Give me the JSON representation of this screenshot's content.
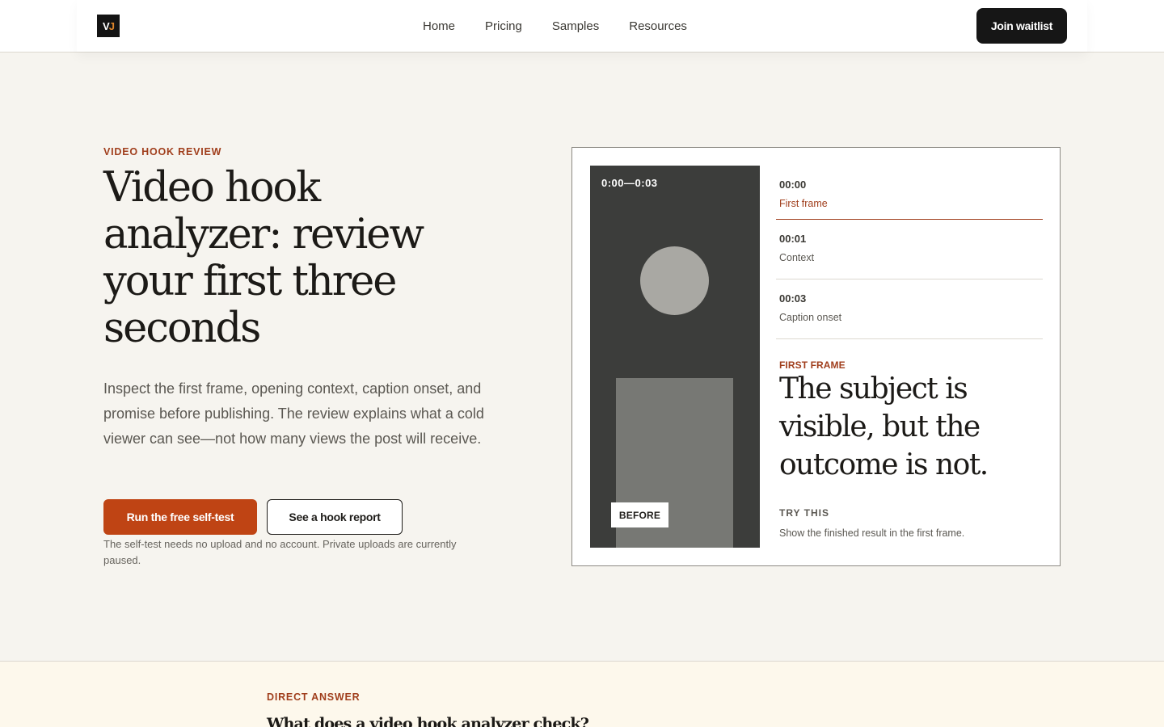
{
  "header": {
    "logo_text_1": "V",
    "logo_text_2": "J",
    "nav": [
      "Home",
      "Pricing",
      "Samples",
      "Resources"
    ],
    "cta": "Join waitlist"
  },
  "hero": {
    "eyebrow": "VIDEO HOOK REVIEW",
    "title": "Video hook analyzer: review your first three seconds",
    "description": "Inspect the first frame, opening context, caption onset, and promise before publishing. The review explains what a cold viewer can see—not how many views the post will receive.",
    "primary_cta": "Run the free self-test",
    "secondary_cta": "See a hook report",
    "note": "The self-test needs no upload and no account. Private uploads are currently paused."
  },
  "preview": {
    "time_range": "0:00—0:03",
    "badge": "BEFORE",
    "timeline": [
      {
        "time": "00:00",
        "label": "First frame"
      },
      {
        "time": "00:01",
        "label": "Context"
      },
      {
        "time": "00:03",
        "label": "Caption onset"
      }
    ],
    "active_index": 0,
    "finding_eyebrow": "FIRST FRAME",
    "finding_title": "The subject is visible, but the outcome is not.",
    "try_label": "TRY THIS",
    "try_text": "Show the finished result in the first frame."
  },
  "answer": {
    "eyebrow": "DIRECT ANSWER",
    "title": "What does a video hook analyzer check?"
  },
  "colors": {
    "accent": "#bf4414",
    "accent_text": "#a03e1c",
    "dark": "#161616",
    "background": "#f6f4ef"
  }
}
